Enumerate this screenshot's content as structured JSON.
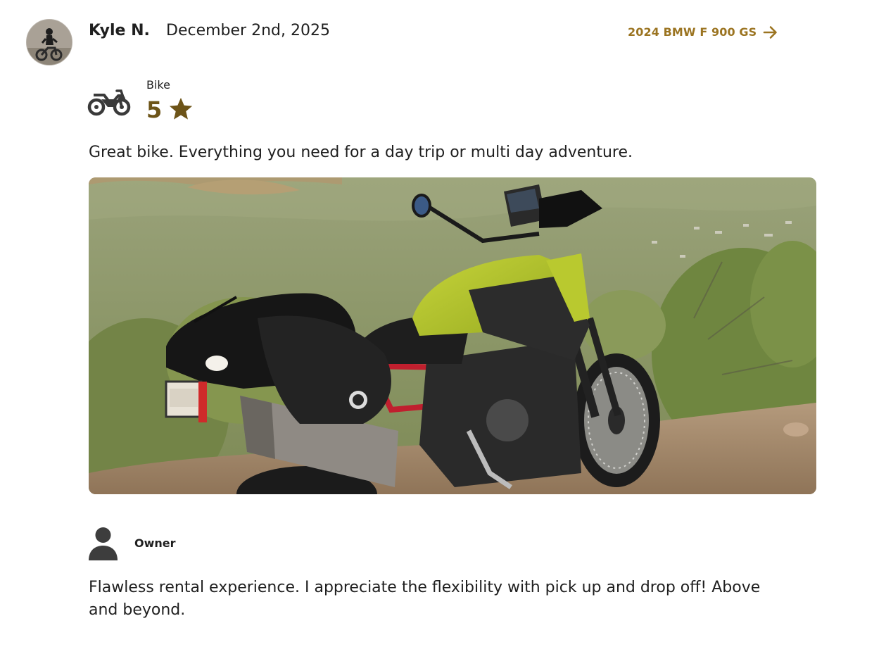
{
  "reviewer": {
    "name": "Kyle N.",
    "date": "December 2nd, 2025"
  },
  "vehicle_link": {
    "label": "2024 BMW F 900 GS",
    "icon": "arrow-right-icon"
  },
  "rating": {
    "category": "Bike",
    "score": "5",
    "category_icon": "motorcycle-icon",
    "score_icon": "star-icon"
  },
  "review": {
    "text": "Great bike. Everything you need for a day trip or multi day adventure."
  },
  "photo": {
    "subject": "motorcycle-photo"
  },
  "owner_response": {
    "label": "Owner",
    "icon": "person-icon",
    "text": "Flawless rental experience. I appreciate the flexibility with pick up and drop off! Above and beyond."
  },
  "colors": {
    "accent": "#9b7421",
    "rating": "#6d5418",
    "text": "#1f1f1f",
    "icon": "#3a3a3a"
  }
}
